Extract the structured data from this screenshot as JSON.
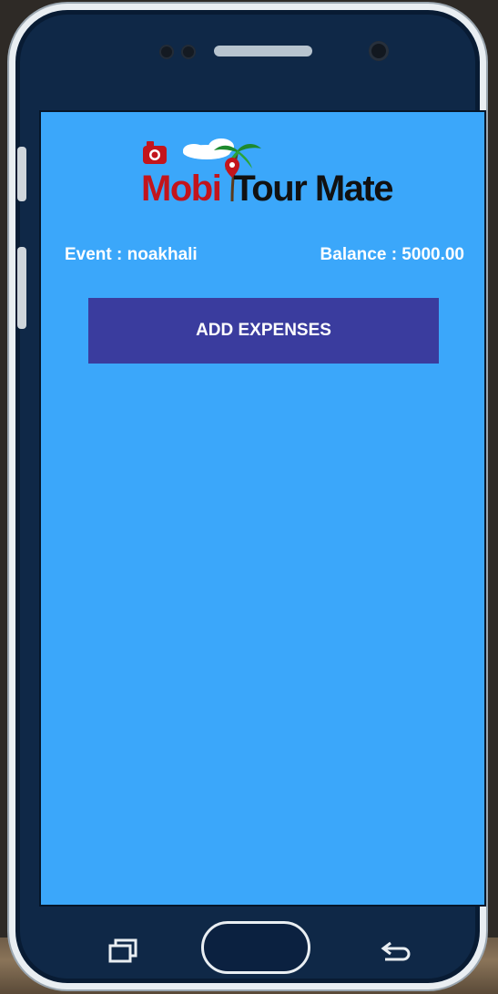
{
  "app": {
    "logo_text": {
      "part1": "Mobi",
      "part2": "Tour Mate"
    }
  },
  "event": {
    "text": "Event : noakhali"
  },
  "balance": {
    "text": "Balance : 5000.00"
  },
  "actions": {
    "add_expenses_label": "ADD EXPENSES"
  },
  "colors": {
    "screen_bg": "#3ba7fa",
    "button_bg": "#3a3c9e",
    "logo_red": "#c3151c",
    "logo_dark": "#111111",
    "phone_body": "#0f2847"
  },
  "icons": {
    "logo": [
      "camera-icon",
      "cloud-icon",
      "palm-tree-icon",
      "map-pin-icon"
    ],
    "nav": [
      "recent-apps-icon",
      "home-button",
      "back-icon"
    ]
  }
}
